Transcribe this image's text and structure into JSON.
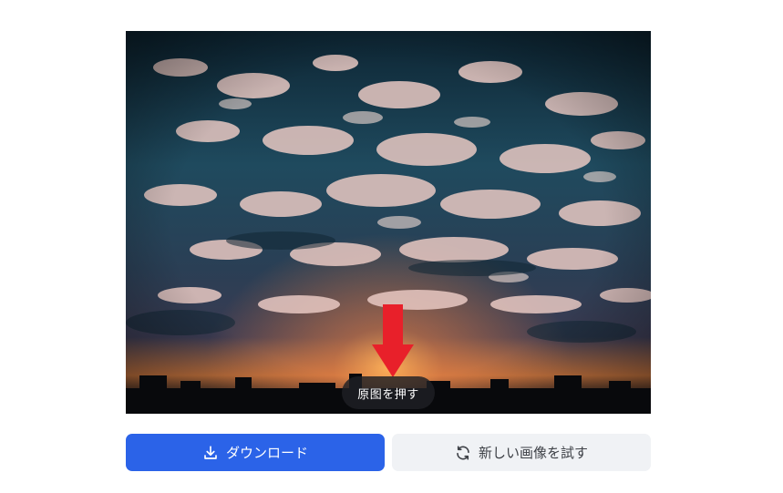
{
  "preview": {
    "image_desc_icon": "sky-photo",
    "hold_label": "原图を押す"
  },
  "actions": {
    "download_label": "ダウンロード",
    "download_icon": "download-icon",
    "retry_label": "新しい画像を試す",
    "retry_icon": "refresh-icon"
  },
  "colors": {
    "primary": "#2b63e8",
    "secondary_bg": "#f0f2f5",
    "arrow": "#e8202a"
  }
}
